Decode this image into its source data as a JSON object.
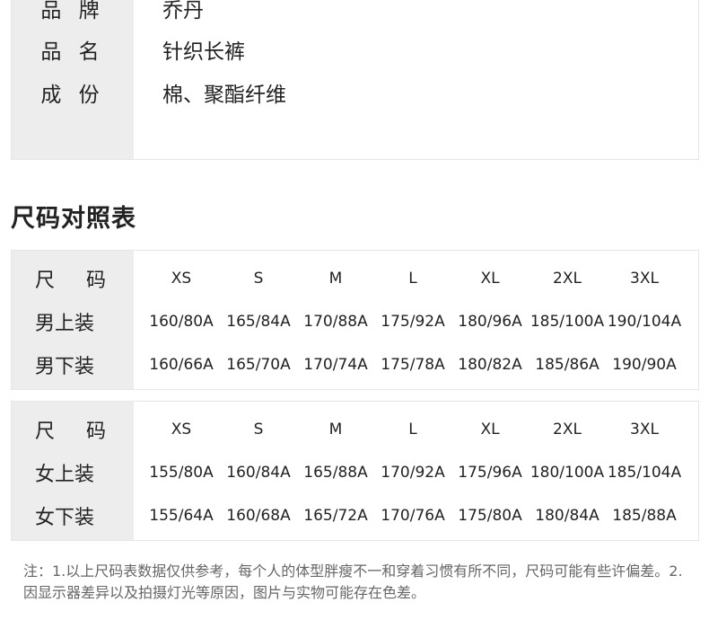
{
  "info": {
    "rows": [
      {
        "label": "品  牌",
        "value": "乔丹"
      },
      {
        "label": "品  名",
        "value": "针织长裤"
      },
      {
        "label": "成  份",
        "value": "棉、聚酯纤维"
      }
    ]
  },
  "size_title": "尺码对照表",
  "men_table": {
    "rows": [
      {
        "label": "尺  码",
        "cells": [
          "XS",
          "S",
          "M",
          "L",
          "XL",
          "2XL",
          "3XL"
        ]
      },
      {
        "label": "男上装",
        "cells": [
          "160/80A",
          "165/84A",
          "170/88A",
          "175/92A",
          "180/96A",
          "185/100A",
          "190/104A"
        ]
      },
      {
        "label": "男下装",
        "cells": [
          "160/66A",
          "165/70A",
          "170/74A",
          "175/78A",
          "180/82A",
          "185/86A",
          "190/90A"
        ]
      }
    ]
  },
  "women_table": {
    "rows": [
      {
        "label": "尺  码",
        "cells": [
          "XS",
          "S",
          "M",
          "L",
          "XL",
          "2XL",
          "3XL"
        ]
      },
      {
        "label": "女上装",
        "cells": [
          "155/80A",
          "160/84A",
          "165/88A",
          "170/92A",
          "175/96A",
          "180/100A",
          "185/104A"
        ]
      },
      {
        "label": "女下装",
        "cells": [
          "155/64A",
          "160/68A",
          "165/72A",
          "170/76A",
          "175/80A",
          "180/84A",
          "185/88A"
        ]
      }
    ]
  },
  "note": "注：1.以上尺码表数据仅供参考，每个人的体型胖瘦不一和穿着习惯有所不同，尺码可能有些许偏差。2.因显示器差异以及拍摄灯光等原因，图片与实物可能存在色差。"
}
